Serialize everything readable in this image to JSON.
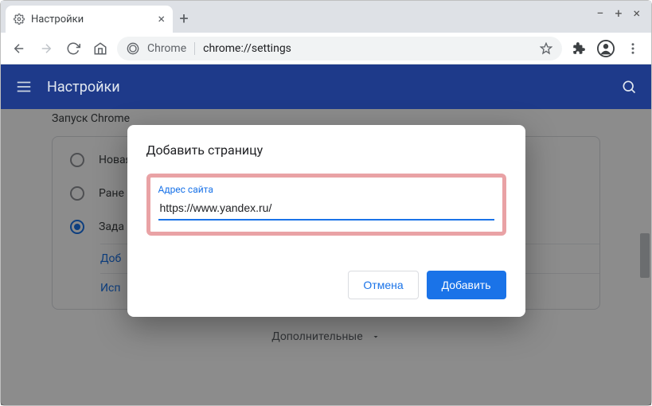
{
  "browser": {
    "tab_title": "Настройки",
    "omnibox": {
      "scheme_label": "Chrome",
      "path": "chrome://settings"
    }
  },
  "header": {
    "title": "Настройки"
  },
  "section": {
    "title": "Запуск Chrome",
    "options": [
      {
        "label": "Новая вкладка",
        "checked": false
      },
      {
        "label": "Ране",
        "checked": false
      },
      {
        "label": "Зада",
        "checked": true
      }
    ],
    "subactions": [
      "Доб",
      "Исп"
    ]
  },
  "footer": {
    "additional_label": "Дополнительные"
  },
  "dialog": {
    "title": "Добавить страницу",
    "field_label": "Адрес сайта",
    "field_value": "https://www.yandex.ru/",
    "cancel_label": "Отмена",
    "submit_label": "Добавить"
  }
}
